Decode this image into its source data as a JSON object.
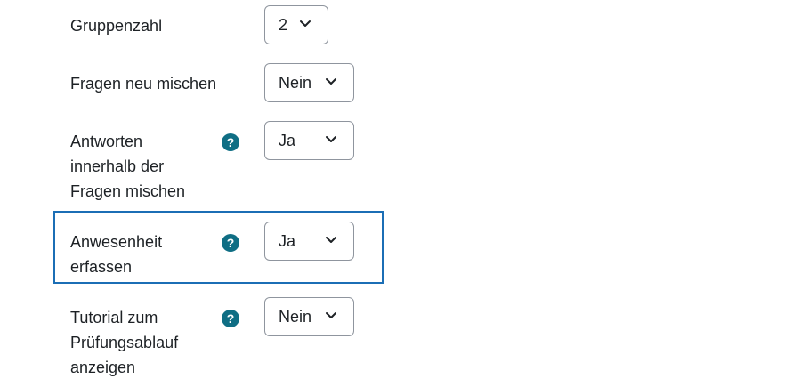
{
  "form": {
    "rows": [
      {
        "label": "Gruppenzahl",
        "help": false,
        "value": "2"
      },
      {
        "label": "Fragen neu mischen",
        "help": false,
        "value": "Nein"
      },
      {
        "label": "Antworten innerhalb der Fragen mischen",
        "help": true,
        "value": "Ja"
      },
      {
        "label": "Anwesenheit erfassen",
        "help": true,
        "value": "Ja",
        "highlighted": true
      },
      {
        "label": "Tutorial zum Prüfungsablauf anzeigen",
        "help": true,
        "value": "Nein"
      }
    ],
    "help_glyph": "?"
  },
  "colors": {
    "help_icon": "#0f6e84",
    "highlight_border": "#1b6eb5",
    "select_border": "#8f959e",
    "text": "#1d2125"
  }
}
